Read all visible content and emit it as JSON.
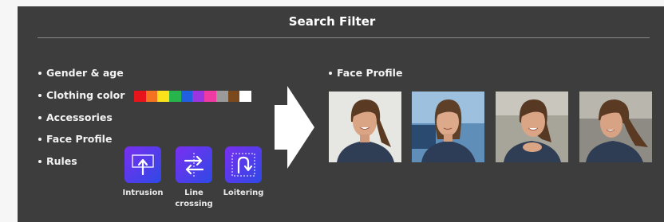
{
  "title": "Search Filter",
  "filters": [
    {
      "label": "Gender & age"
    },
    {
      "label": "Clothing color"
    },
    {
      "label": "Accessories"
    },
    {
      "label": "Face Profile"
    },
    {
      "label": "Rules"
    }
  ],
  "clothing_colors": [
    "#e8141c",
    "#f47320",
    "#f9e21a",
    "#27b44a",
    "#1f5fe0",
    "#9b35e0",
    "#f03aa3",
    "#9a9a9a",
    "#7a4a1e",
    "#ffffff"
  ],
  "rules": [
    {
      "label": "Intrusion",
      "icon": "intrusion-icon"
    },
    {
      "label": "Line crossing",
      "icon": "line-crossing-icon"
    },
    {
      "label": "Loitering",
      "icon": "loitering-icon"
    }
  ],
  "face_profile": {
    "label": "Face Profile",
    "images": [
      {
        "name": "face-photo-1"
      },
      {
        "name": "face-photo-2"
      },
      {
        "name": "face-photo-3"
      },
      {
        "name": "face-photo-4"
      }
    ]
  }
}
